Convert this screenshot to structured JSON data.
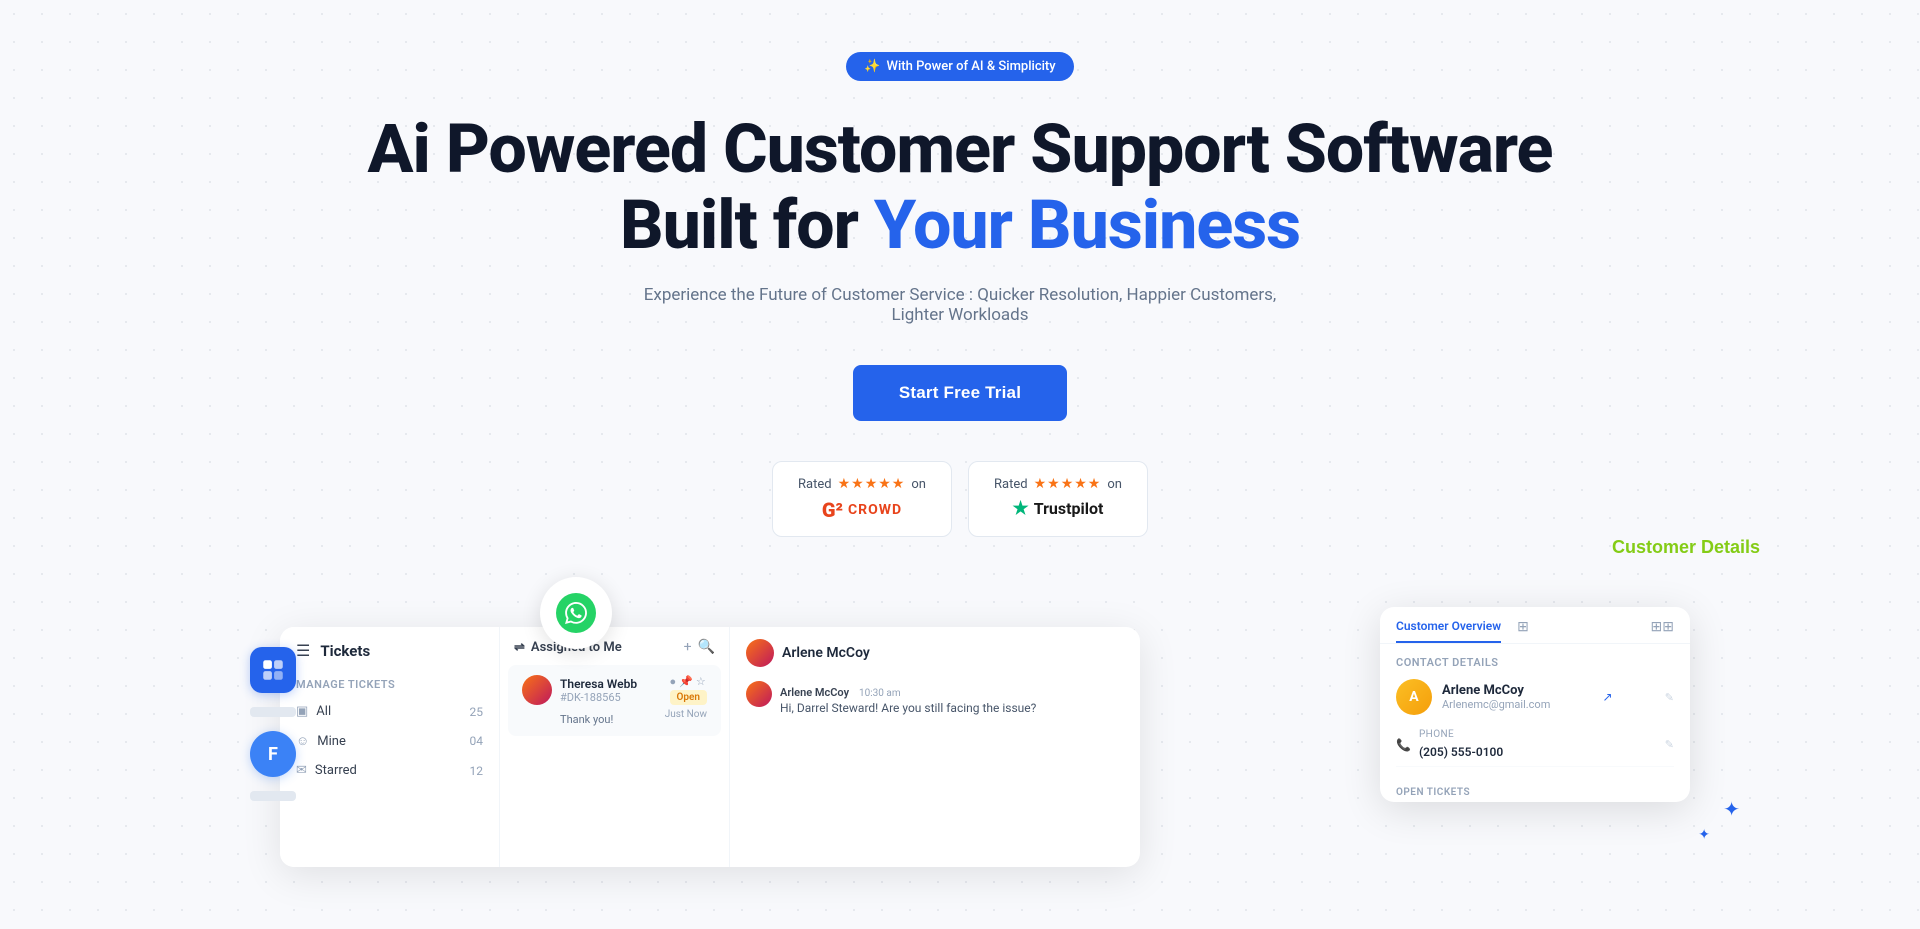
{
  "badge": {
    "icon": "✨",
    "text": "With Power of AI & Simplicity"
  },
  "hero": {
    "line1": "Ai Powered Customer Support Software",
    "line2_prefix": "Built for ",
    "line2_highlight": "Your Business",
    "subtitle": "Experience the Future of Customer Service : Quicker Resolution, Happier Customers, Lighter Workloads",
    "cta": "Start Free Trial"
  },
  "ratings": [
    {
      "label": "Rated",
      "stars": "★★★★★",
      "platform_type": "g2",
      "on_text": "on",
      "logo_symbol": "G²",
      "logo_text": "CROWD"
    },
    {
      "label": "Rated",
      "stars": "★★★★★",
      "platform_type": "trustpilot",
      "on_text": "on",
      "logo_text": "Trustpilot"
    }
  ],
  "ui_preview": {
    "tickets_panel": {
      "title": "Tickets",
      "manage_label": "Manage Tickets",
      "nav_items": [
        {
          "icon": "▣",
          "label": "All",
          "count": "25"
        },
        {
          "icon": "☺",
          "label": "Mine",
          "count": "04"
        },
        {
          "icon": "✉",
          "label": "Starred",
          "count": "12"
        }
      ]
    },
    "assigned_panel": {
      "title": "Assigned to Me",
      "ticket": {
        "name": "Theresa Webb",
        "id": "#DK-188565",
        "status": "Open",
        "message": "Thank you!",
        "time": "Just Now"
      }
    },
    "chat_panel": {
      "contact_name": "Arlene McCoy",
      "message": {
        "sender": "Arlene McCoy",
        "time": "10:30 am",
        "text": "Hi, Darrel Steward! Are you still facing the issue?"
      }
    },
    "customer_details": {
      "tab_label": "Customer Overview",
      "section_label": "Contact Details",
      "person": {
        "name": "Arlene McCoy",
        "email": "Arlenemc@gmail.com"
      },
      "phone_label": "PHONE",
      "phone": "(205) 555-0100",
      "open_tickets_label": "OPEN TICKETS"
    },
    "annotation": "Customer Details"
  }
}
